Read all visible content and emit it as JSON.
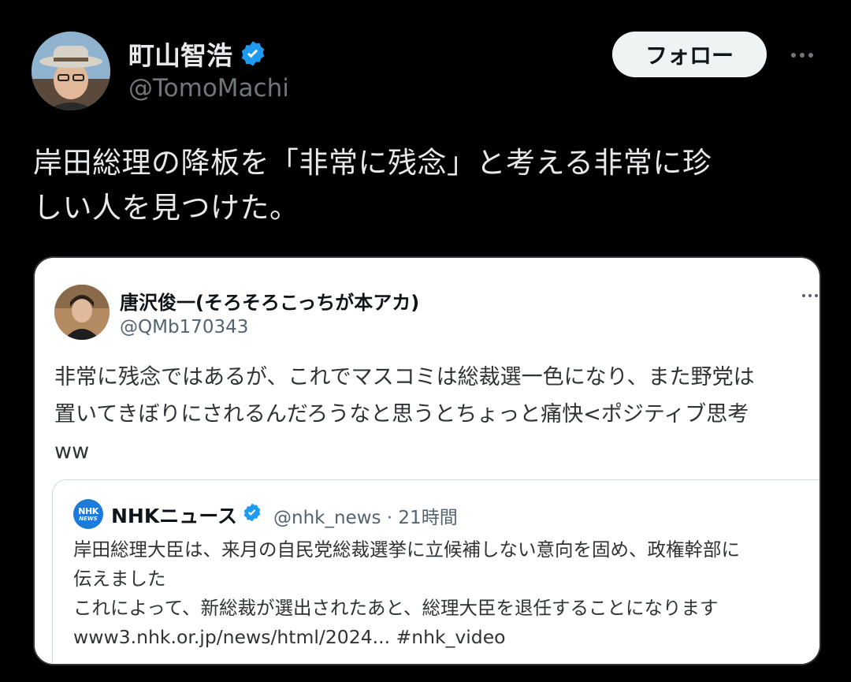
{
  "author": {
    "name": "町山智浩",
    "handle": "@TomoMachi",
    "verified": true
  },
  "actions": {
    "follow_label": "フォロー",
    "more_icon": "more-horizontal-icon"
  },
  "tweet": {
    "lines": [
      "岸田総理の降板を「非常に残念」と考える非常に珍",
      "しい人を見つけた。"
    ]
  },
  "quoted": {
    "name": "唐沢俊一(そろそろこっちが本アカ)",
    "handle": "@QMb170343",
    "lines": [
      "非常に残念ではあるが、これでマスコミは総裁選一色になり、また野党は",
      "置いてきぼりにされるんだろうなと思うとちょっと痛快<ポジティブ思考",
      "ww"
    ],
    "embedded": {
      "logo_top": "NHK",
      "logo_bottom": "NEWS",
      "name": "NHKニュース",
      "meta": "@nhk_news · 21時間",
      "lines": [
        "岸田総理大臣は、来月の自民党総裁選挙に立候補しない意向を固め、政権幹部に",
        "伝えました",
        "これによって、新総裁が選出されたあと、総理大臣を退任することになります",
        "www3.nhk.or.jp/news/html/2024... #nhk_video"
      ]
    }
  },
  "colors": {
    "background": "#000000",
    "verified_blue": "#1d9bf0",
    "nhk_blue": "#1d7bd8"
  }
}
